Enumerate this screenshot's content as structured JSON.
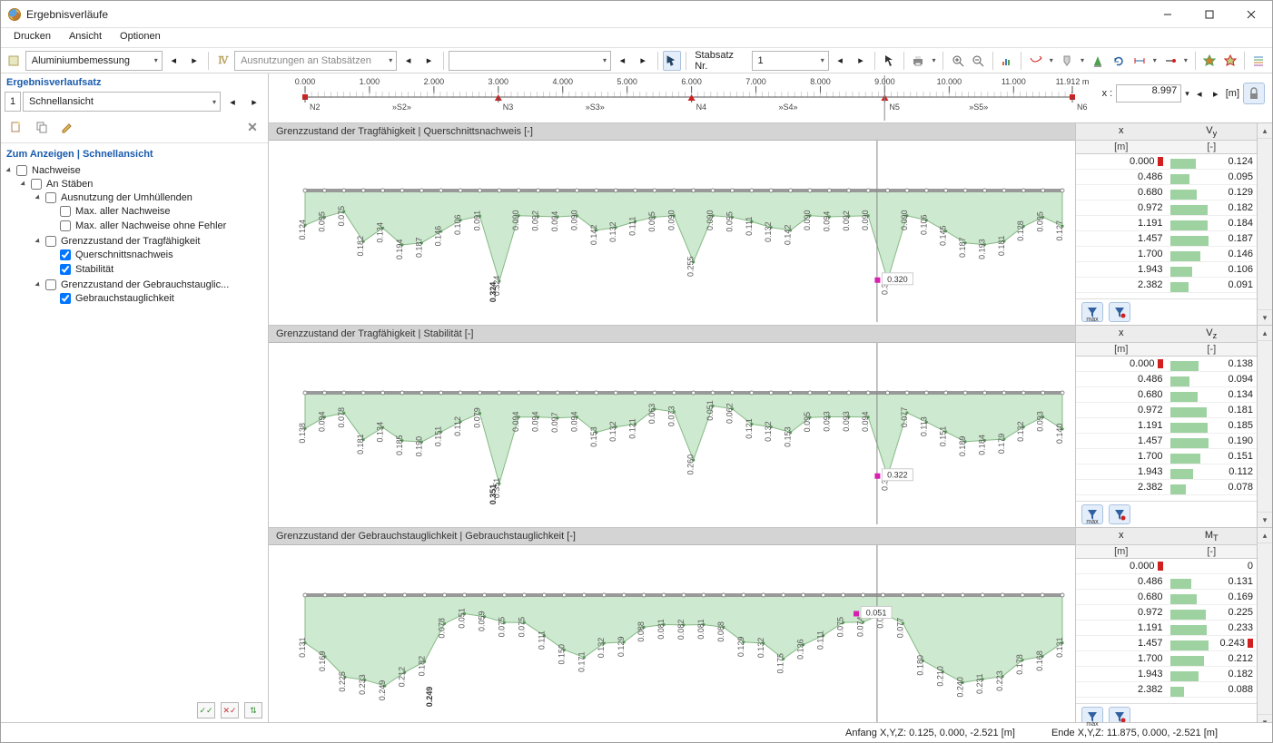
{
  "titlebar": {
    "title": "Ergebnisverläufe"
  },
  "menubar": {
    "items": [
      "Drucken",
      "Ansicht",
      "Optionen"
    ]
  },
  "toolbar1": {
    "calc_type": "Aluminiumbemessung",
    "combo2": "Ausnutzungen an Stabsätzen",
    "stabsatz_label": "Stabsatz Nr.",
    "stabsatz_value": "1"
  },
  "sidebar": {
    "header": "Ergebnisverlaufsatz",
    "set_idx": "1",
    "set_combo": "Schnellansicht",
    "section_title": "Zum Anzeigen | Schnellansicht",
    "tree": {
      "nachweise": "Nachweise",
      "an_staben": "An Stäben",
      "ausnutzung": "Ausnutzung der Umhüllenden",
      "max_nachweise": "Max. aller Nachweise",
      "max_nachweise_ohne": "Max. aller Nachweise ohne Fehler",
      "gz_trag": "Grenzzustand der Tragfähigkeit",
      "qnachweis": "Querschnittsnachweis",
      "stabilitat": "Stabilität",
      "gz_gebr": "Grenzzustand der Gebrauchstauglic...",
      "gebrauch": "Gebrauchstauglichkeit"
    }
  },
  "ruler": {
    "ticks": [
      "0.000",
      "1.000",
      "2.000",
      "3.000",
      "4.000",
      "5.000",
      "6.000",
      "7.000",
      "8.000",
      "9.000",
      "10.000",
      "11.000",
      "11.912 m"
    ],
    "nodes_top": [
      "N2",
      "N3",
      "N4",
      "N5",
      "N6"
    ],
    "nodes_bottom": [
      "N2",
      "»S2»",
      "N3",
      "»S3»",
      "N4",
      "»S4»",
      "N5",
      "»S5»",
      "N6"
    ],
    "readout_label": "x :",
    "readout_value": "8.997",
    "readout_unit": "[m]"
  },
  "charts": [
    {
      "title": "Grenzzustand der Tragfähigkeit | Querschnittsnachweis [-]",
      "marker": {
        "x_frac": 0.7559,
        "value": "0.320"
      },
      "peak": {
        "x_frac": 0.252,
        "value": "0.324"
      },
      "values": [
        0.124,
        0.095,
        0.075,
        0.182,
        0.134,
        0.194,
        0.187,
        0.146,
        0.106,
        0.091,
        0.324,
        0.09,
        0.092,
        0.094,
        0.09,
        0.142,
        0.132,
        0.111,
        0.095,
        0.09,
        0.255,
        0.09,
        0.095,
        0.111,
        0.132,
        0.142,
        0.09,
        0.094,
        0.092,
        0.09,
        0.32,
        0.09,
        0.106,
        0.145,
        0.187,
        0.193,
        0.181,
        0.128,
        0.095,
        0.127
      ],
      "table": {
        "col1": "x",
        "col2": "V",
        "sub": "y",
        "u1": "[m]",
        "u2": "[-]",
        "rows": [
          {
            "x": "0.000",
            "c": "red",
            "v": "0.124",
            "bar": 0.124
          },
          {
            "x": "0.486",
            "c": "",
            "v": "0.095",
            "bar": 0.095
          },
          {
            "x": "0.680",
            "c": "",
            "v": "0.129",
            "bar": 0.129
          },
          {
            "x": "0.972",
            "c": "",
            "v": "0.182",
            "bar": 0.182
          },
          {
            "x": "1.191",
            "c": "",
            "v": "0.184",
            "bar": 0.184
          },
          {
            "x": "1.457",
            "c": "",
            "v": "0.187",
            "bar": 0.187
          },
          {
            "x": "1.700",
            "c": "",
            "v": "0.146",
            "bar": 0.146
          },
          {
            "x": "1.943",
            "c": "",
            "v": "0.106",
            "bar": 0.106
          },
          {
            "x": "2.382",
            "c": "",
            "v": "0.091",
            "bar": 0.091
          }
        ]
      }
    },
    {
      "title": "Grenzzustand der Tragfähigkeit | Stabilität [-]",
      "marker": {
        "x_frac": 0.7559,
        "value": "0.322"
      },
      "peak": {
        "x_frac": 0.252,
        "value": "0.351"
      },
      "values": [
        0.138,
        0.094,
        0.078,
        0.181,
        0.134,
        0.185,
        0.19,
        0.151,
        0.112,
        0.079,
        0.351,
        0.094,
        0.094,
        0.097,
        0.094,
        0.153,
        0.132,
        0.121,
        0.063,
        0.073,
        0.26,
        0.051,
        0.062,
        0.121,
        0.132,
        0.153,
        0.095,
        0.093,
        0.093,
        0.094,
        0.322,
        0.077,
        0.113,
        0.151,
        0.189,
        0.184,
        0.179,
        0.132,
        0.093,
        0.14
      ],
      "table": {
        "col1": "x",
        "col2": "V",
        "sub": "z",
        "u1": "[m]",
        "u2": "[-]",
        "rows": [
          {
            "x": "0.000",
            "c": "red",
            "v": "0.138",
            "bar": 0.138
          },
          {
            "x": "0.486",
            "c": "",
            "v": "0.094",
            "bar": 0.094
          },
          {
            "x": "0.680",
            "c": "",
            "v": "0.134",
            "bar": 0.134
          },
          {
            "x": "0.972",
            "c": "",
            "v": "0.181",
            "bar": 0.181
          },
          {
            "x": "1.191",
            "c": "",
            "v": "0.185",
            "bar": 0.185
          },
          {
            "x": "1.457",
            "c": "",
            "v": "0.190",
            "bar": 0.19
          },
          {
            "x": "1.700",
            "c": "",
            "v": "0.151",
            "bar": 0.151
          },
          {
            "x": "1.943",
            "c": "",
            "v": "0.112",
            "bar": 0.112
          },
          {
            "x": "2.382",
            "c": "",
            "v": "0.078",
            "bar": 0.078
          }
        ]
      }
    },
    {
      "title": "Grenzzustand der Gebrauchstauglichkeit | Gebrauchstauglichkeit [-]",
      "marker": {
        "x_frac": 0.7279,
        "value": "0.051"
      },
      "peak": {
        "x_frac": 0.168,
        "value": "0.249"
      },
      "values": [
        0.131,
        0.169,
        0.225,
        0.233,
        0.249,
        0.212,
        0.182,
        0.078,
        0.051,
        0.059,
        0.075,
        0.075,
        0.111,
        0.15,
        0.171,
        0.132,
        0.129,
        0.088,
        0.081,
        0.082,
        0.081,
        0.088,
        0.129,
        0.132,
        0.175,
        0.136,
        0.111,
        0.075,
        0.074,
        0.051,
        0.077,
        0.18,
        0.21,
        0.24,
        0.231,
        0.223,
        0.178,
        0.168,
        0.131
      ],
      "table": {
        "col1": "x",
        "col2": "M",
        "sub": "T",
        "u1": "[m]",
        "u2": "[-]",
        "rows": [
          {
            "x": "0.000",
            "c": "red",
            "v": "0",
            "bar": 0.0
          },
          {
            "x": "0.486",
            "c": "",
            "v": "0.131",
            "bar": 0.131
          },
          {
            "x": "0.680",
            "c": "",
            "v": "0.169",
            "bar": 0.169
          },
          {
            "x": "0.972",
            "c": "",
            "v": "0.225",
            "bar": 0.225
          },
          {
            "x": "1.191",
            "c": "",
            "v": "0.233",
            "bar": 0.233
          },
          {
            "x": "1.457",
            "c": "red2",
            "v": "0.243",
            "bar": 0.243
          },
          {
            "x": "1.700",
            "c": "",
            "v": "0.212",
            "bar": 0.212
          },
          {
            "x": "1.943",
            "c": "",
            "v": "0.182",
            "bar": 0.182
          },
          {
            "x": "2.382",
            "c": "",
            "v": "0.088",
            "bar": 0.088
          }
        ]
      }
    }
  ],
  "filter_max": "max",
  "status": {
    "anfang": "Anfang X,Y,Z: 0.125, 0.000, -2.521 [m]",
    "ende": "Ende X,Y,Z: 11.875, 0.000, -2.521 [m]"
  },
  "chart_data": {
    "type": "line",
    "x_range_m": [
      0.0,
      11.912
    ],
    "cursor_x_m": 8.997,
    "series": [
      {
        "name": "Querschnittsnachweis",
        "unit": "[-]",
        "max": 0.324,
        "marker": 0.32
      },
      {
        "name": "Stabilität",
        "unit": "[-]",
        "max": 0.351,
        "marker": 0.322
      },
      {
        "name": "Gebrauchstauglichkeit",
        "unit": "[-]",
        "max": 0.249,
        "marker": 0.051
      }
    ]
  }
}
